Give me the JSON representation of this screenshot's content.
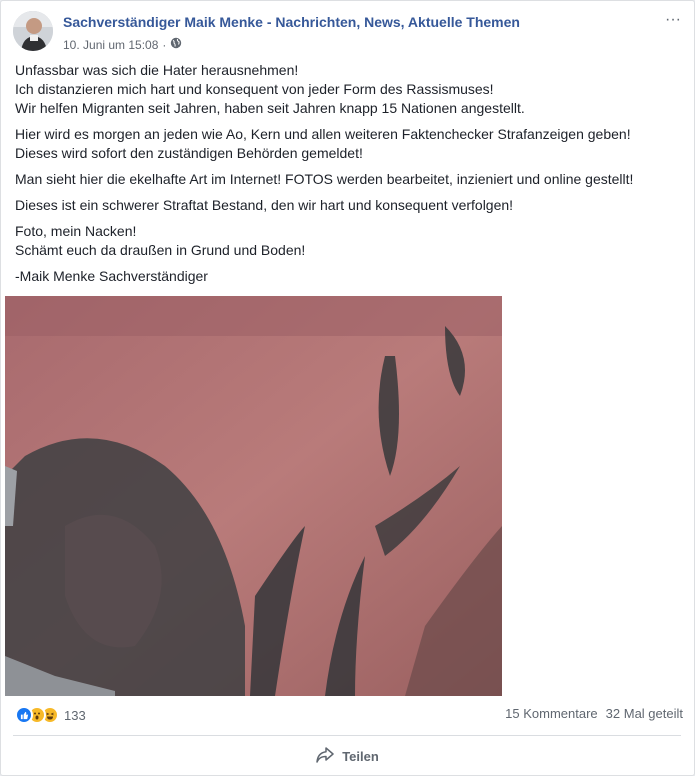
{
  "post": {
    "author": "Sachverständiger Maik Menke - Nachrichten, News, Aktuelle Themen",
    "date": "10. Juni um 15:08",
    "separator": "·",
    "audience_icon": "globe-icon",
    "paragraphs": [
      [
        "Unfassbar was sich die Hater herausnehmen!",
        "Ich distanzieren mich hart und konsequent von jeder Form des Rassismuses!",
        "Wir helfen Migranten seit Jahren, haben seit Jahren knapp 15 Nationen angestellt."
      ],
      [
        "Hier wird es morgen an jeden wie Ao, Kern und allen weiteren Faktenchecker Strafanzeigen geben!",
        "Dieses wird sofort den zuständigen Behörden gemeldet!"
      ],
      [
        "Man sieht hier die ekelhafte Art im Internet! FOTOS werden bearbeitet, inzieniert und online gestellt!"
      ],
      [
        "Dieses ist ein schwerer Straftat Bestand, den wir hart und konsequent verfolgen!"
      ],
      [
        "Foto, mein Nacken!",
        "Schämt euch da draußen in Grund und Boden!"
      ],
      [
        "-Maik Menke Sachverständiger"
      ]
    ]
  },
  "stats": {
    "reactions": [
      "like-icon",
      "wow-icon",
      "haha-icon"
    ],
    "reaction_count": "133",
    "comments": "15 Kommentare",
    "shares": "32 Mal geteilt"
  },
  "actions": {
    "share_label": "Teilen",
    "share_icon": "share-arrow-icon"
  },
  "colors": {
    "link": "#365899",
    "like": "#1877f2",
    "muted": "#606770"
  }
}
